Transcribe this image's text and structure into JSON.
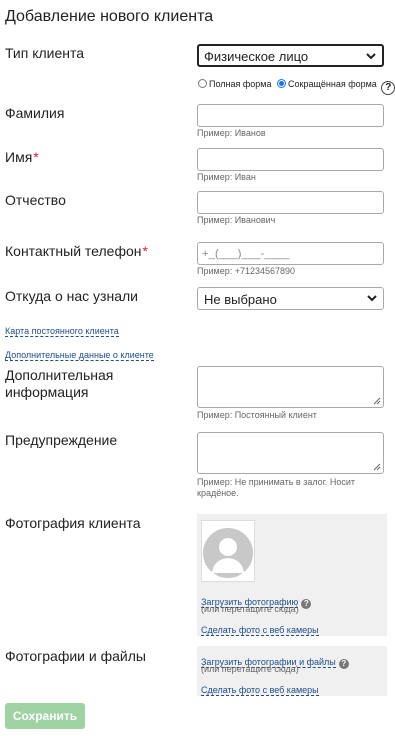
{
  "page": {
    "title": "Добавление нового клиента"
  },
  "client_type": {
    "label": "Тип клиента",
    "selected": "Физическое лицо",
    "form_options": [
      {
        "label": "Полная форма",
        "selected": false
      },
      {
        "label": "Сокращённая форма",
        "selected": true
      }
    ],
    "help_icon": "?"
  },
  "fields": {
    "last_name": {
      "label": "Фамилия",
      "value": "",
      "hint": "Пример: Иванов"
    },
    "first_name": {
      "label": "Имя",
      "required_mark": "*",
      "value": "",
      "hint": "Пример: Иван"
    },
    "patronymic": {
      "label": "Отчество",
      "value": "",
      "hint": "Пример: Иванович"
    },
    "phone": {
      "label": "Контактный телефон",
      "required_mark": "*",
      "placeholder": "+_(___)___-____",
      "hint": "Пример: +71234567890"
    },
    "source": {
      "label": "Откуда о нас узнали",
      "selected": "Не выбрано"
    },
    "additional_info": {
      "label": "Дополнительная информация",
      "value": "",
      "hint": "Пример: Постоянный клиент"
    },
    "warning": {
      "label": "Предупреждение",
      "value": "",
      "hint": "Пример: Не принимать в залог. Носит крадёное."
    }
  },
  "links": {
    "loyalty_card": "Карта постоянного клиента",
    "extra_data": "Дополнительные данные о клиенте"
  },
  "photo": {
    "label": "Фотография клиента",
    "upload_link": "Загрузить фотографию",
    "drag_note": "(или перетащите сюда)",
    "webcam_link": "Сделать фото с веб камеры",
    "help_icon": "?"
  },
  "files": {
    "label": "Фотографии и файлы",
    "upload_link": "Загрузить фотографии и файлы",
    "drag_note": "(или перетащите сюда)",
    "webcam_link": "Сделать фото с веб камеры",
    "help_icon": "?"
  },
  "actions": {
    "save_label": "Сохранить"
  },
  "colors": {
    "link": "#1f4e8a",
    "required": "#d9232d",
    "save_button": "#9fd3a3",
    "panel": "#f0f0f0",
    "radio_selected": "#1a73e8"
  }
}
